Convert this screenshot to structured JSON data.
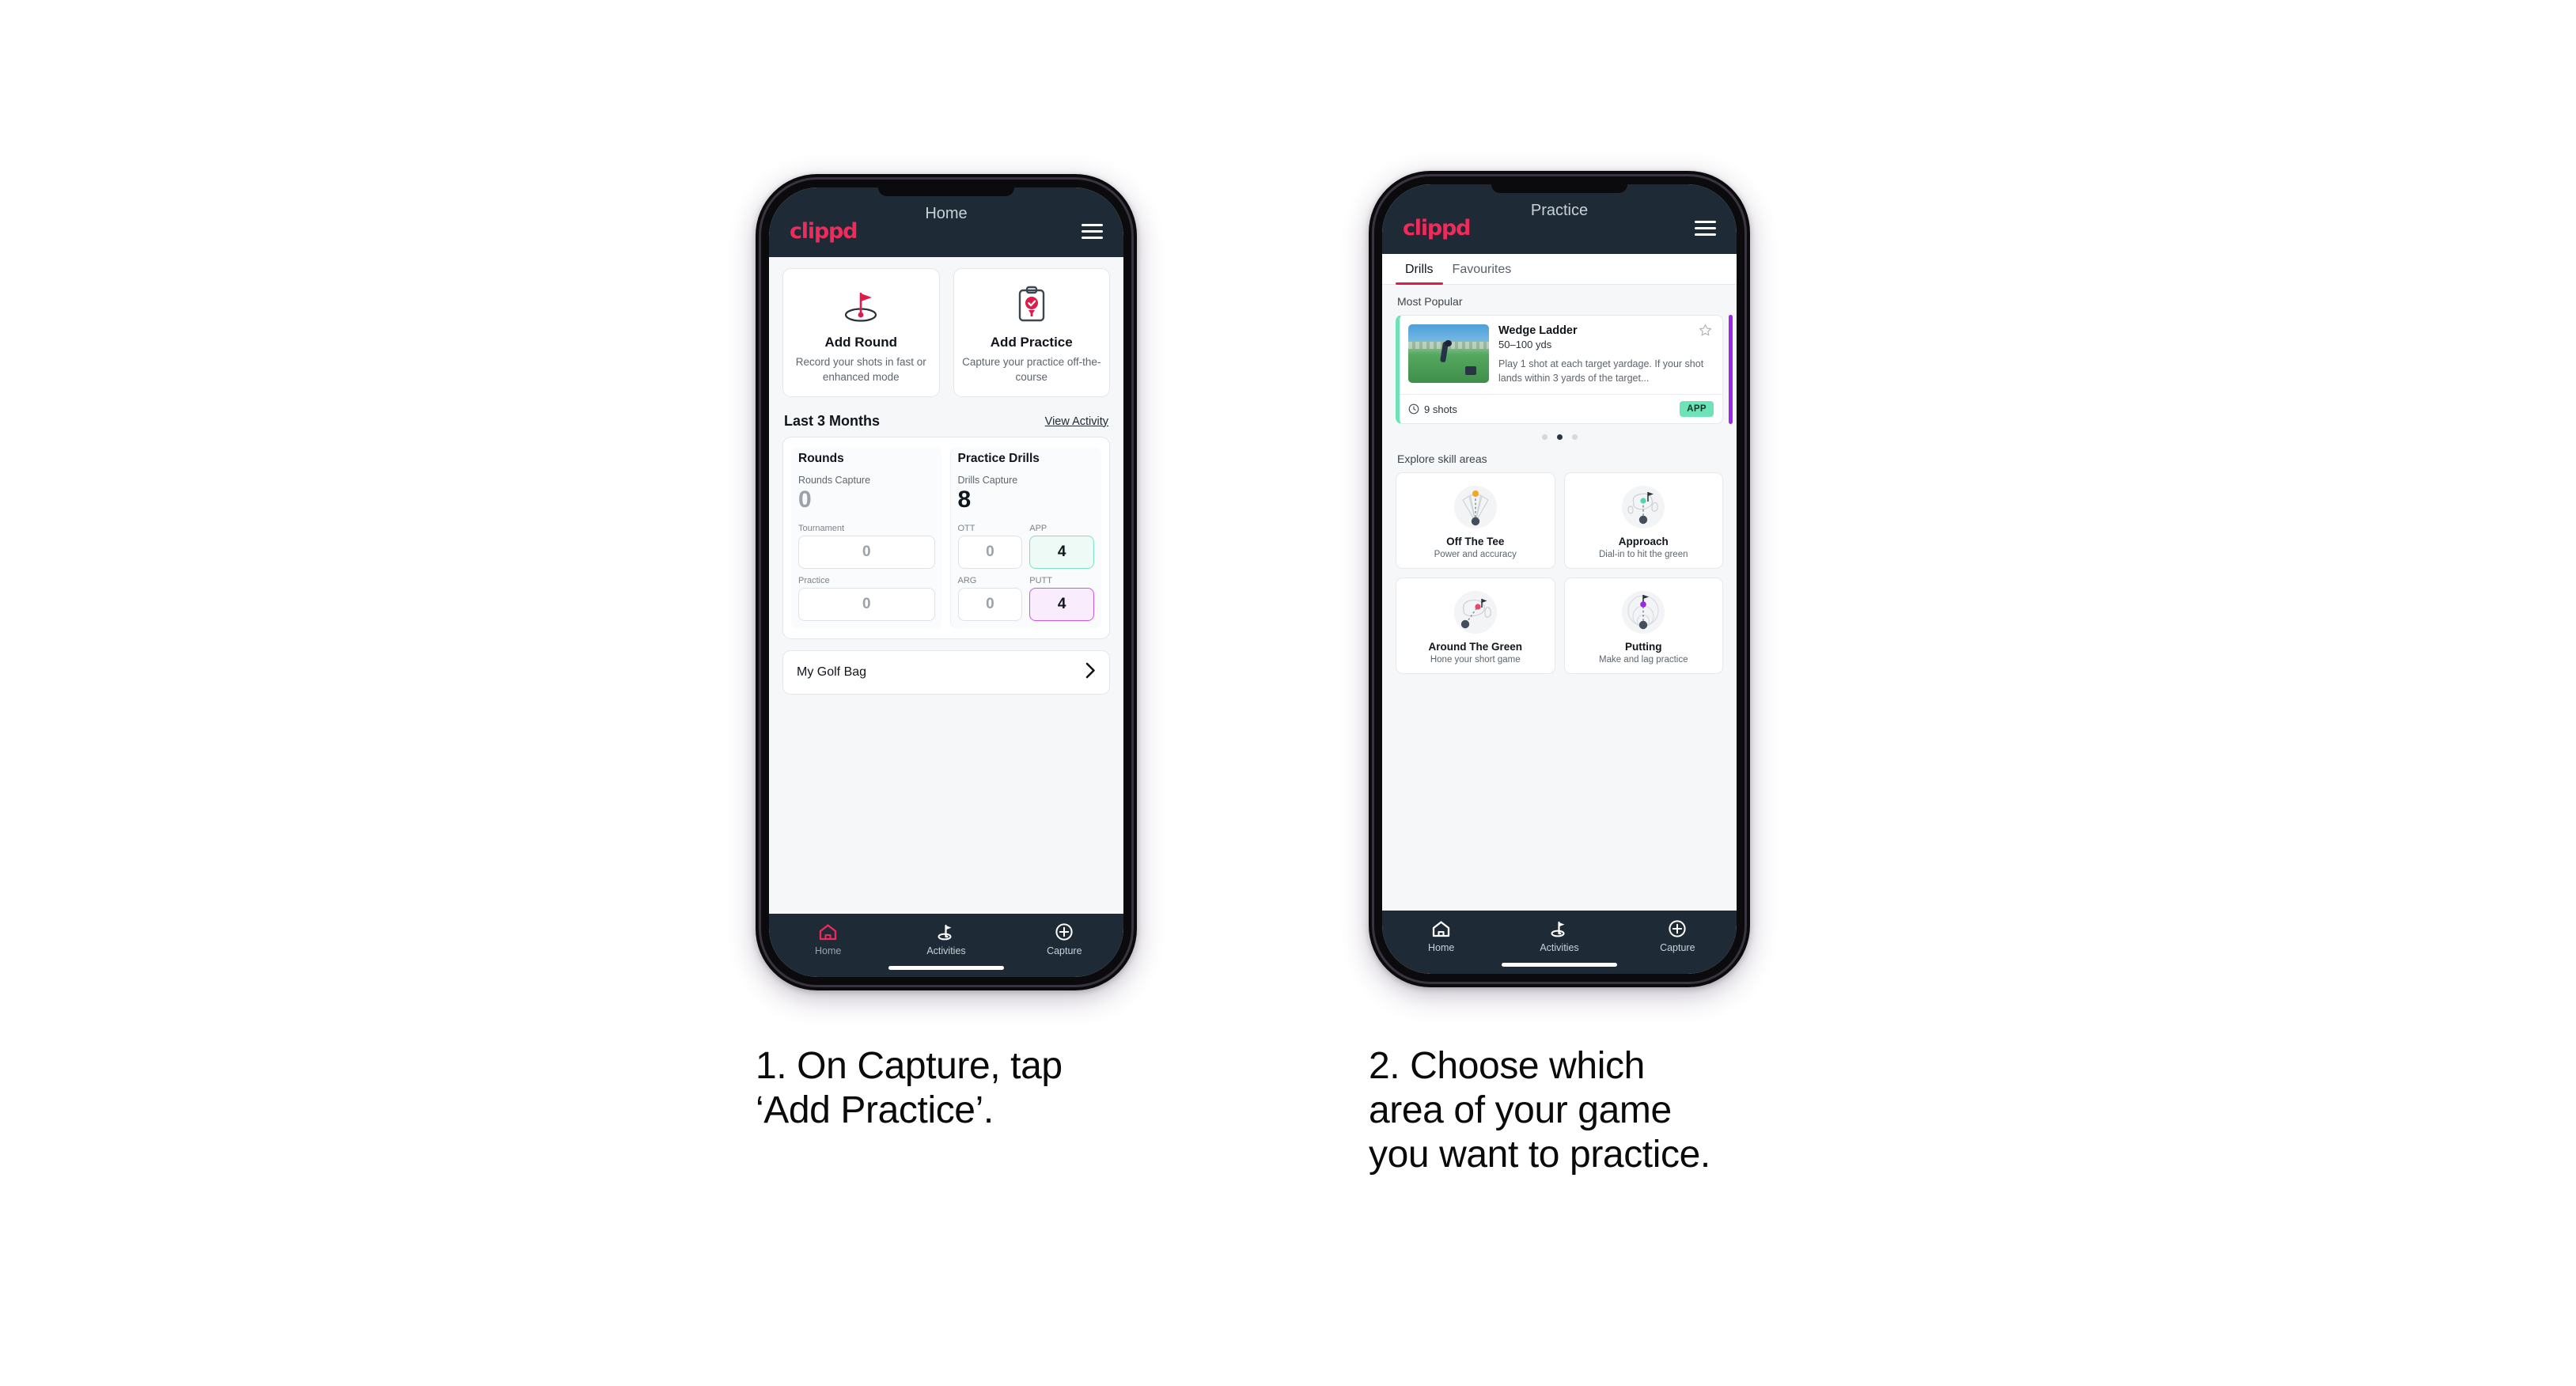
{
  "phone1": {
    "appbar": {
      "logo": "clippd",
      "title": "Home",
      "menu_icon": "hamburger-icon"
    },
    "actions": [
      {
        "icon": "golf-flag-hole-icon",
        "title": "Add Round",
        "sub": "Record your shots in fast or enhanced mode"
      },
      {
        "icon": "clipboard-check-tee-icon",
        "title": "Add Practice",
        "sub": "Capture your practice off-the-course"
      }
    ],
    "section": {
      "title": "Last 3 Months",
      "link": "View Activity"
    },
    "rounds": {
      "header": "Rounds",
      "caption": "Rounds Capture",
      "value": "0",
      "tiles": [
        {
          "label": "Tournament",
          "value": "0",
          "style": "plain"
        },
        {
          "label": "Practice",
          "value": "0",
          "style": "plain"
        }
      ]
    },
    "drills": {
      "header": "Practice Drills",
      "caption": "Drills Capture",
      "value": "8",
      "tiles": [
        {
          "label": "OTT",
          "value": "0",
          "style": "plain"
        },
        {
          "label": "APP",
          "value": "4",
          "style": "app"
        },
        {
          "label": "ARG",
          "value": "0",
          "style": "plain"
        },
        {
          "label": "PUTT",
          "value": "4",
          "style": "putt"
        }
      ]
    },
    "golf_bag": {
      "label": "My Golf Bag",
      "chevron": "chevron-right-icon"
    },
    "nav": [
      {
        "icon": "home-icon",
        "label": "Home",
        "active": true
      },
      {
        "icon": "golf-flag-icon",
        "label": "Activities",
        "active": false
      },
      {
        "icon": "plus-circle-icon",
        "label": "Capture",
        "active": false
      }
    ]
  },
  "phone2": {
    "appbar": {
      "logo": "clippd",
      "title": "Practice",
      "menu_icon": "hamburger-icon"
    },
    "tabs": [
      {
        "label": "Drills",
        "active": true
      },
      {
        "label": "Favourites",
        "active": false
      }
    ],
    "most_popular_label": "Most Popular",
    "drill": {
      "name": "Wedge Ladder",
      "yardage": "50–100 yds",
      "description": "Play 1 shot at each target yardage. If your shot lands within 3 yards of the target...",
      "shots": "9 shots",
      "shots_icon": "clock-icon",
      "badge": "APP",
      "star_icon": "star-outline-icon",
      "accent": "#6fe3b8",
      "next_accent": "#9c27e8"
    },
    "carousel": {
      "count": 3,
      "active_index": 1
    },
    "explore_label": "Explore skill areas",
    "skills": [
      {
        "icon": "tee-shot-fan-icon",
        "title": "Off The Tee",
        "sub": "Power and accuracy"
      },
      {
        "icon": "approach-green-icon",
        "title": "Approach",
        "sub": "Dial-in to hit the green"
      },
      {
        "icon": "around-green-icon",
        "title": "Around The Green",
        "sub": "Hone your short game"
      },
      {
        "icon": "putting-rings-icon",
        "title": "Putting",
        "sub": "Make and lag practice"
      }
    ],
    "nav": [
      {
        "icon": "home-icon",
        "label": "Home",
        "active": false
      },
      {
        "icon": "golf-flag-icon",
        "label": "Activities",
        "active": false
      },
      {
        "icon": "plus-circle-icon",
        "label": "Capture",
        "active": false
      }
    ]
  },
  "captions": {
    "one": "1. On Capture, tap\n‘Add Practice’.",
    "two": "2. Choose which\narea of your game\nyou want to practice."
  },
  "colors": {
    "brand_pink": "#ef2b5c",
    "appbar": "#1e2a35",
    "app_green": "#6fe3b8",
    "putt_purple": "#c659e8",
    "tab_underline": "#e01b4c"
  }
}
